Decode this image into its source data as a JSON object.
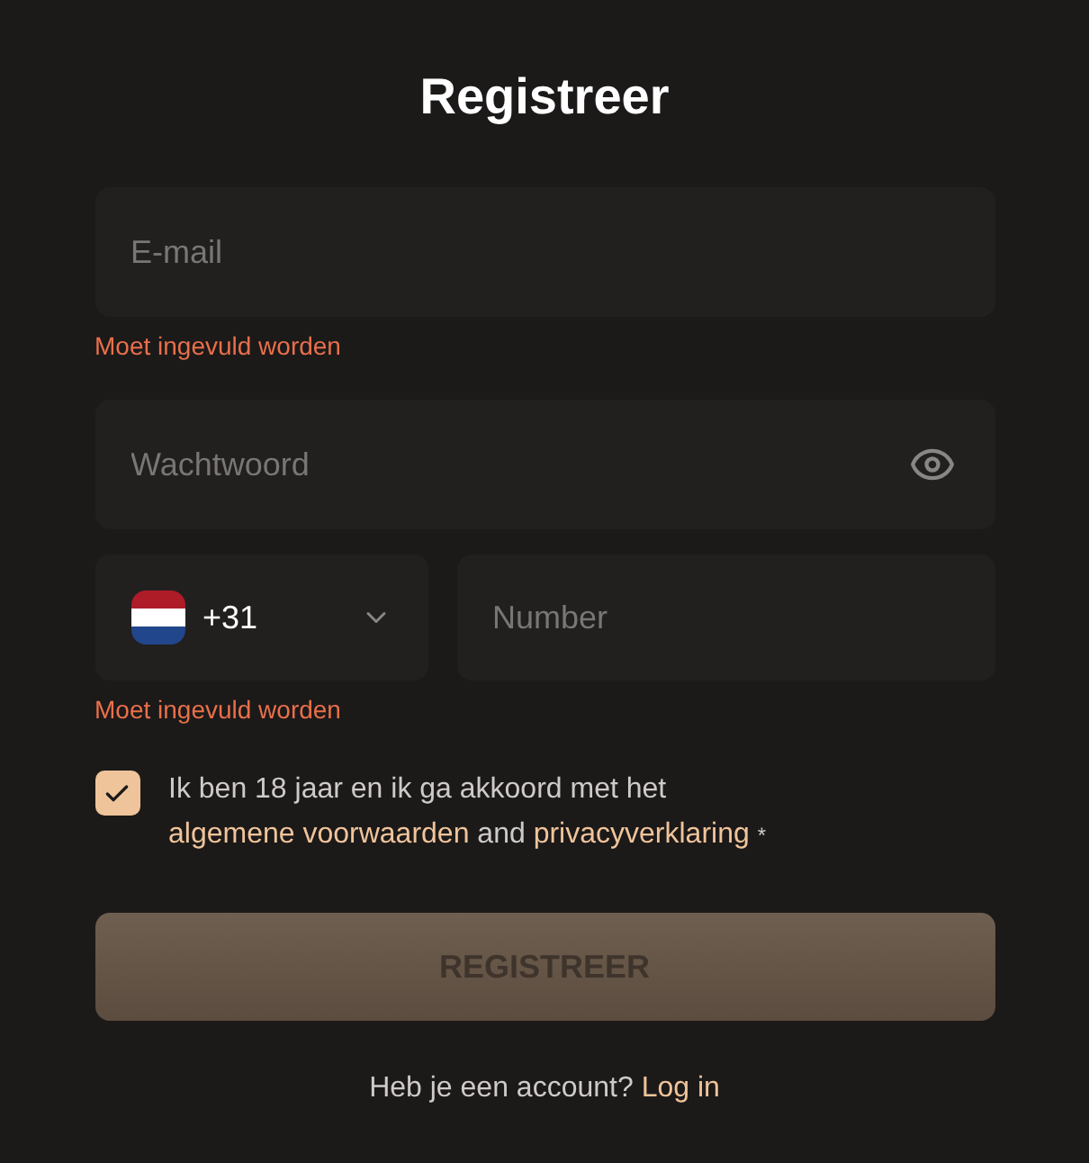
{
  "title": "Registreer",
  "email": {
    "placeholder": "E-mail",
    "error": "Moet ingevuld worden"
  },
  "password": {
    "placeholder": "Wachtwoord"
  },
  "phone": {
    "country_code": "+31",
    "placeholder": "Number",
    "error": "Moet ingevuld worden"
  },
  "consent": {
    "checked": true,
    "text_before": "Ik ben 18 jaar en ik ga akkoord met het",
    "link_1": "algemene voorwaarden",
    "text_middle": "and",
    "link_2": "privacyverklaring",
    "required_mark": "*"
  },
  "submit": {
    "label": "REGISTREER",
    "disabled": true
  },
  "footer": {
    "question": "Heb je een account?",
    "link": "Log in"
  }
}
